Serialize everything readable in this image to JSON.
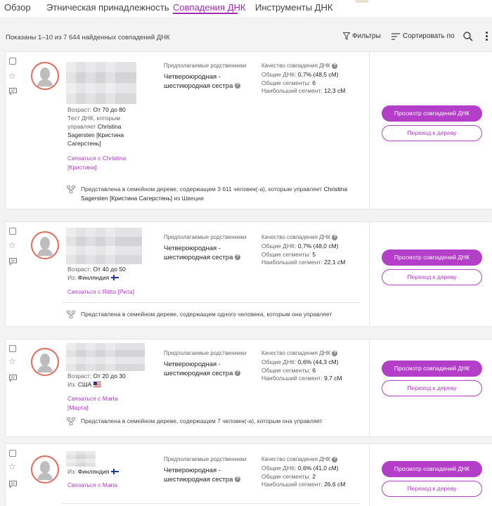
{
  "tabs": [
    "Обзор",
    "Этническая принадлежность",
    "Совпадения ДНК",
    "Инструменты ДНК"
  ],
  "active_tab": "Совпадения ДНК",
  "toolbar": {
    "results": "Показаны 1–10 из 7 644 найденных совпадений ДНК",
    "filters": "Фильтры",
    "sort": "Сортировать по"
  },
  "labels": {
    "relationship": "Предполагаемые родственники",
    "quality": "Качество совпадения ДНК",
    "shared_dna": "Общие ДНК:",
    "shared_segments": "Общие сегменты:",
    "largest_segment": "Наибольший сегмент:",
    "age": "Возраст:",
    "from": "Из:",
    "view_button": "Просмотр совпадений ДНК",
    "tree_button": "Переход к дереву"
  },
  "colors": {
    "accent": "#b33ec8",
    "avatar_ring": "#e46a5b"
  },
  "matches": [
    {
      "age": "От 70 до 80",
      "managed_prefix": "Тест ДНК, которым управляет",
      "managed_by": "Christina Sagersten [Кристина Сагерстень]",
      "contact": "Связаться с Christina [Кристина]",
      "relationship": "Четвероюродная - шестиюродная сестра",
      "shared_dna": "0,7% (48,5 сМ)",
      "segments": "6",
      "largest": "12,3 сМ",
      "tree_prefix": "Представлена в семейном дереве, содержащем 3 611 человек(-а), которым управляет",
      "tree_owner": "Christina Sagersten [Кристина Сагерстень]",
      "tree_suffix": "из Швеции"
    },
    {
      "age": "От 40 до 50",
      "from": "Финляндия",
      "contact": "Связаться с Riitta [Рита]",
      "relationship": "Четвероюродная - шестиюродная сестра",
      "shared_dna": "0,7% (48,0 сМ)",
      "segments": "5",
      "largest": "22,1 сМ",
      "tree": "Представлена в семейном дереве, содержащем одного человека, которым она управляет"
    },
    {
      "age": "От 20 до 30",
      "from": "США",
      "contact": "Связаться с Marta [Марта]",
      "relationship": "Четвероюродная - шестиюродная сестра",
      "shared_dna": "0,6% (44,3 сМ)",
      "segments": "6",
      "largest": "9,7 сМ",
      "tree": "Представлена в семейном дереве, содержащем 7 человек(-а), которым она управляет"
    },
    {
      "from": "Финляндия",
      "contact": "Связаться с Maria",
      "relationship": "Четвероюродная - шестиюродная сестра",
      "shared_dna": "0,6% (41,0 сМ)",
      "segments": "2",
      "largest": "26,6 сМ"
    }
  ]
}
